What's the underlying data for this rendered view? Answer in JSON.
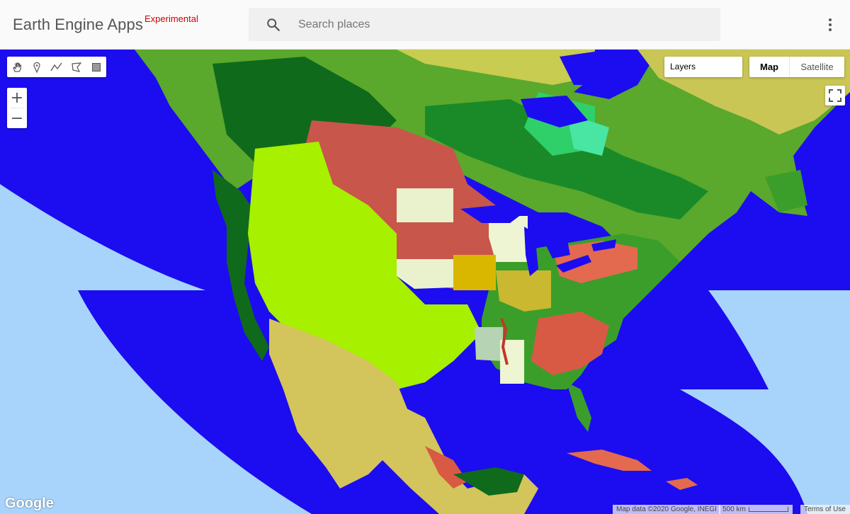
{
  "header": {
    "app_title": "Earth Engine Apps",
    "badge": "Experimental",
    "badge_color": "#d20000",
    "search_placeholder": "Search places",
    "search_icon": "search-icon",
    "menu_icon": "more-vert-icon"
  },
  "map": {
    "ocean_color": "#1c0cf0",
    "no_data_color": "#a8d4fb",
    "toolbar_tools": [
      "hand-pan-icon",
      "marker-icon",
      "polyline-icon",
      "polygon-icon",
      "rectangle-icon"
    ],
    "zoom_in_label": "+",
    "zoom_out_label": "−",
    "layers_label": "Layers",
    "map_type_map": "Map",
    "map_type_satellite": "Satellite",
    "fullscreen_icon": "fullscreen-icon",
    "google_logo": "Google",
    "attribution": "Map data ©2020 Google, INEGI",
    "scale_label": "500 km",
    "terms_label": "Terms of Use"
  }
}
